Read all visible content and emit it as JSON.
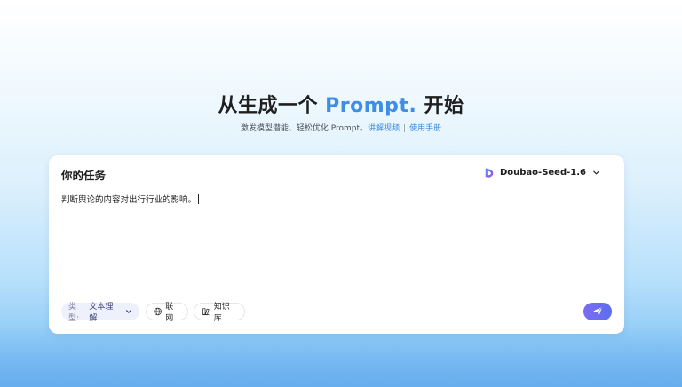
{
  "hero": {
    "title_prefix": "从生成一个",
    "title_accent": "Prompt.",
    "title_suffix": "开始",
    "subtitle": "激发模型潜能、轻松优化 Prompt。",
    "link_video": "讲解视频",
    "separator": "|",
    "link_manual": "使用手册"
  },
  "card": {
    "title": "你的任务",
    "model_name": "Doubao-Seed-1.6",
    "task_text": "判断舆论的内容对出行行业的影响。"
  },
  "chips": {
    "type_label": "类型:",
    "type_value": "文本理解",
    "web_label": "联网",
    "kb_label": "知识库"
  },
  "colors": {
    "accent": "#3d8ee4",
    "send_button": "#6b6df1",
    "link": "#3a86e0"
  },
  "icons": {
    "model": "doubao-logo-icon",
    "model_dropdown": "chevron-down-icon",
    "type_dropdown": "chevron-down-icon",
    "web": "globe-icon",
    "kb": "book-icon",
    "send": "paper-plane-icon"
  }
}
